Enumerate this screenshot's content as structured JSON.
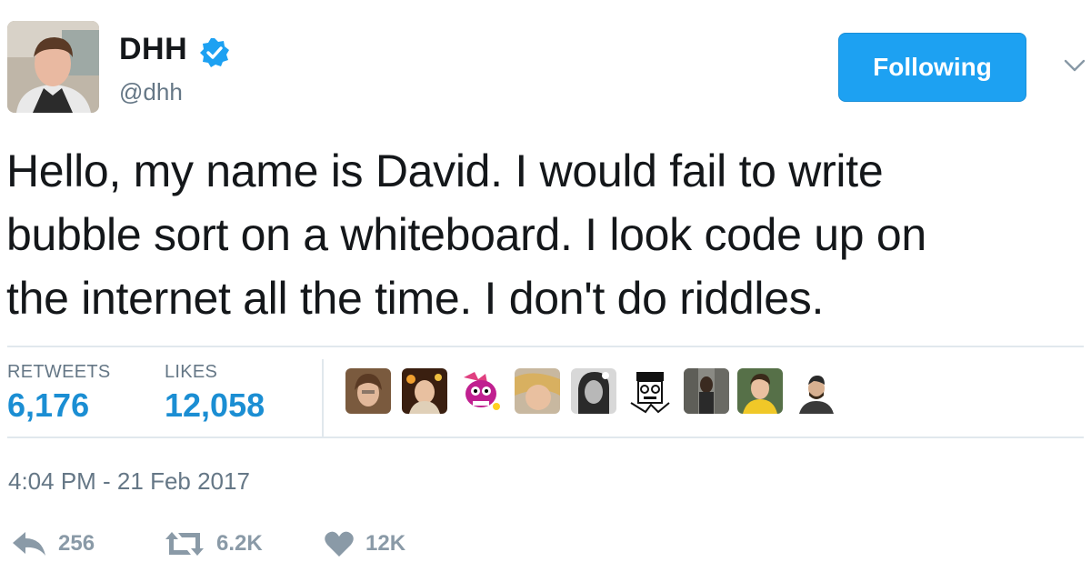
{
  "header": {
    "display_name": "DHH",
    "handle": "@dhh",
    "follow_button": "Following",
    "icons": [
      "avatar",
      "verified-badge-icon",
      "chevron-down-icon"
    ],
    "colors": {
      "accent": "#1da1f2",
      "stat_value": "#1b8ed3",
      "muted": "#657786"
    }
  },
  "tweet": {
    "lines": [
      "Hello, my name is David. I would fail to write",
      "bubble sort on a whiteboard. I look code up on",
      "the internet all the time. I don't do riddles."
    ]
  },
  "stats": {
    "retweets_label": "RETWEETS",
    "retweets_value": "6,176",
    "likes_label": "LIKES",
    "likes_value": "12,058"
  },
  "timestamp": "4:04 PM - 21 Feb 2017",
  "actions": {
    "reply_count": "256",
    "retweet_count": "6.2K",
    "like_count": "12K",
    "icons": [
      "reply-icon",
      "retweet-icon",
      "heart-icon"
    ]
  }
}
